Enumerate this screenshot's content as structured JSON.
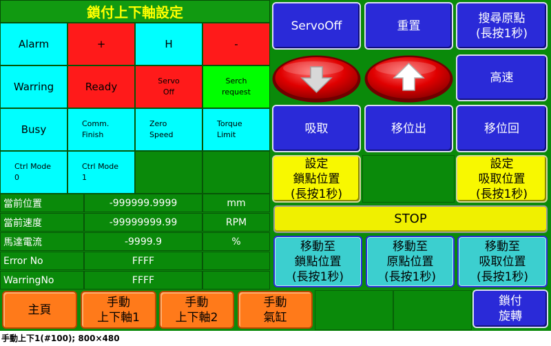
{
  "title": "鎖付上下軸設定",
  "status_grid": [
    [
      {
        "lines": [
          "Alarm"
        ]
      },
      {
        "lines": [
          "+"
        ]
      },
      {
        "lines": [
          "H"
        ]
      },
      {
        "lines": [
          "-"
        ]
      }
    ],
    [
      {
        "lines": [
          "Warring"
        ]
      },
      {
        "lines": [
          "Ready"
        ]
      },
      {
        "lines": [
          "Servo",
          "Off"
        ]
      },
      {
        "lines": [
          "Serch",
          "request"
        ]
      }
    ],
    [
      {
        "lines": [
          "Busy"
        ]
      },
      {
        "lines": [
          "Comm.",
          "Finish"
        ]
      },
      {
        "lines": [
          "Zero",
          "Speed"
        ]
      },
      {
        "lines": [
          "Torque",
          "Limit"
        ]
      }
    ],
    [
      {
        "lines": [
          "Ctrl Mode",
          "0"
        ]
      },
      {
        "lines": [
          "Ctrl Mode",
          "1"
        ]
      },
      {
        "lines": [
          ""
        ]
      },
      {
        "lines": [
          ""
        ]
      }
    ]
  ],
  "readouts": [
    {
      "label": "當前位置",
      "value": "-999999.9999",
      "unit": "mm"
    },
    {
      "label": "當前速度",
      "value": "-99999999.99",
      "unit": "RPM"
    },
    {
      "label": "馬達電流",
      "value": "-9999.9",
      "unit": "%"
    },
    {
      "label": "Error No",
      "value": "FFFF",
      "unit": ""
    },
    {
      "label": "WarringNo",
      "value": "FFFF",
      "unit": ""
    }
  ],
  "buttons": {
    "servo_off": "ServoOff",
    "reset": "重置",
    "search_origin": [
      "搜尋原點",
      "(長按1秒)"
    ],
    "high_speed": "高速",
    "suction": "吸取",
    "move_out": "移位出",
    "move_back": "移位回",
    "set_lock_pos": [
      "設定",
      "鎖點位置",
      "(長按1秒)"
    ],
    "set_suction_pos": [
      "設定",
      "吸取位置",
      "(長按1秒)"
    ],
    "stop": "STOP",
    "move_to_lock": [
      "移動至",
      "鎖點位置",
      "(長按1秒)"
    ],
    "move_to_origin": [
      "移動至",
      "原點位置",
      "(長按1秒)"
    ],
    "move_to_suction": [
      "移動至",
      "吸取位置",
      "(長按1秒)"
    ]
  },
  "nav": {
    "home": "主頁",
    "manual_axis1": [
      "手動",
      "上下軸1"
    ],
    "manual_axis2": [
      "手動",
      "上下軸2"
    ],
    "manual_cylinder": [
      "手動",
      "氣缸"
    ],
    "lock_rotate": [
      "鎖付",
      "旋轉"
    ]
  },
  "status_line": "手動上下1(#100); 800×480",
  "colors": {
    "background": "#0a8a0a",
    "title_text": "#ffff00",
    "indicator_on_red": "#ff1a1a",
    "indicator_cyan": "#00ffff",
    "indicator_green": "#00ff00",
    "button_blue": "#2a2ad8",
    "button_yellow": "#f8f800",
    "button_teal": "#3ccfcf",
    "button_orange": "#ff7a1a",
    "arrow_button_red": "#e00000"
  },
  "icons": {
    "down_arrow": "arrow-down-icon",
    "up_arrow": "arrow-up-icon"
  }
}
